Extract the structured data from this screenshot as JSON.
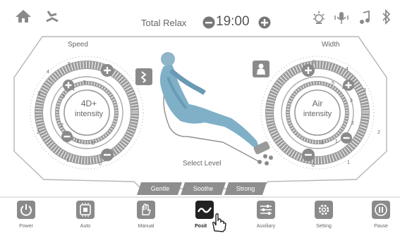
{
  "header": {
    "title": "Total Relax",
    "timer": "19:00",
    "icons": [
      "home-icon",
      "recline-icon",
      "light-icon",
      "voice-icon",
      "music-icon",
      "bluetooth-icon"
    ]
  },
  "left_dial": {
    "label": "Speed",
    "center_line1": "4D+",
    "center_line2": "intensity",
    "outer_numbers": [
      "5",
      "4",
      "3",
      "2",
      "1",
      "0"
    ],
    "inner_numbers": [
      "5",
      "4",
      "3",
      "2",
      "1",
      "0"
    ]
  },
  "right_dial": {
    "label": "Width",
    "center_line1": "Air",
    "center_line2": "intensity",
    "outer_numbers": [
      "5",
      "4",
      "3",
      "2",
      "1",
      "0"
    ],
    "inner_numbers": [
      "5",
      "4",
      "3",
      "2",
      "1",
      "0"
    ]
  },
  "center": {
    "select_level": "Select Level"
  },
  "level_tabs": [
    "Gentle",
    "Soothe",
    "Strong"
  ],
  "nav": [
    {
      "label": "Power",
      "icon": "power-icon"
    },
    {
      "label": "Auto",
      "icon": "auto-icon"
    },
    {
      "label": "Manual",
      "icon": "hand-icon"
    },
    {
      "label": "Posit",
      "icon": "position-icon"
    },
    {
      "label": "Auxiliary",
      "icon": "sliders-icon"
    },
    {
      "label": "Setting",
      "icon": "gear-icon"
    },
    {
      "label": "Pause",
      "icon": "pause-icon"
    }
  ],
  "colors": {
    "panel_line": "#9a9a9a",
    "dial_gray": "#8c8c8c",
    "body_blue": "#7fb0c8",
    "active_nav": "#222222"
  }
}
